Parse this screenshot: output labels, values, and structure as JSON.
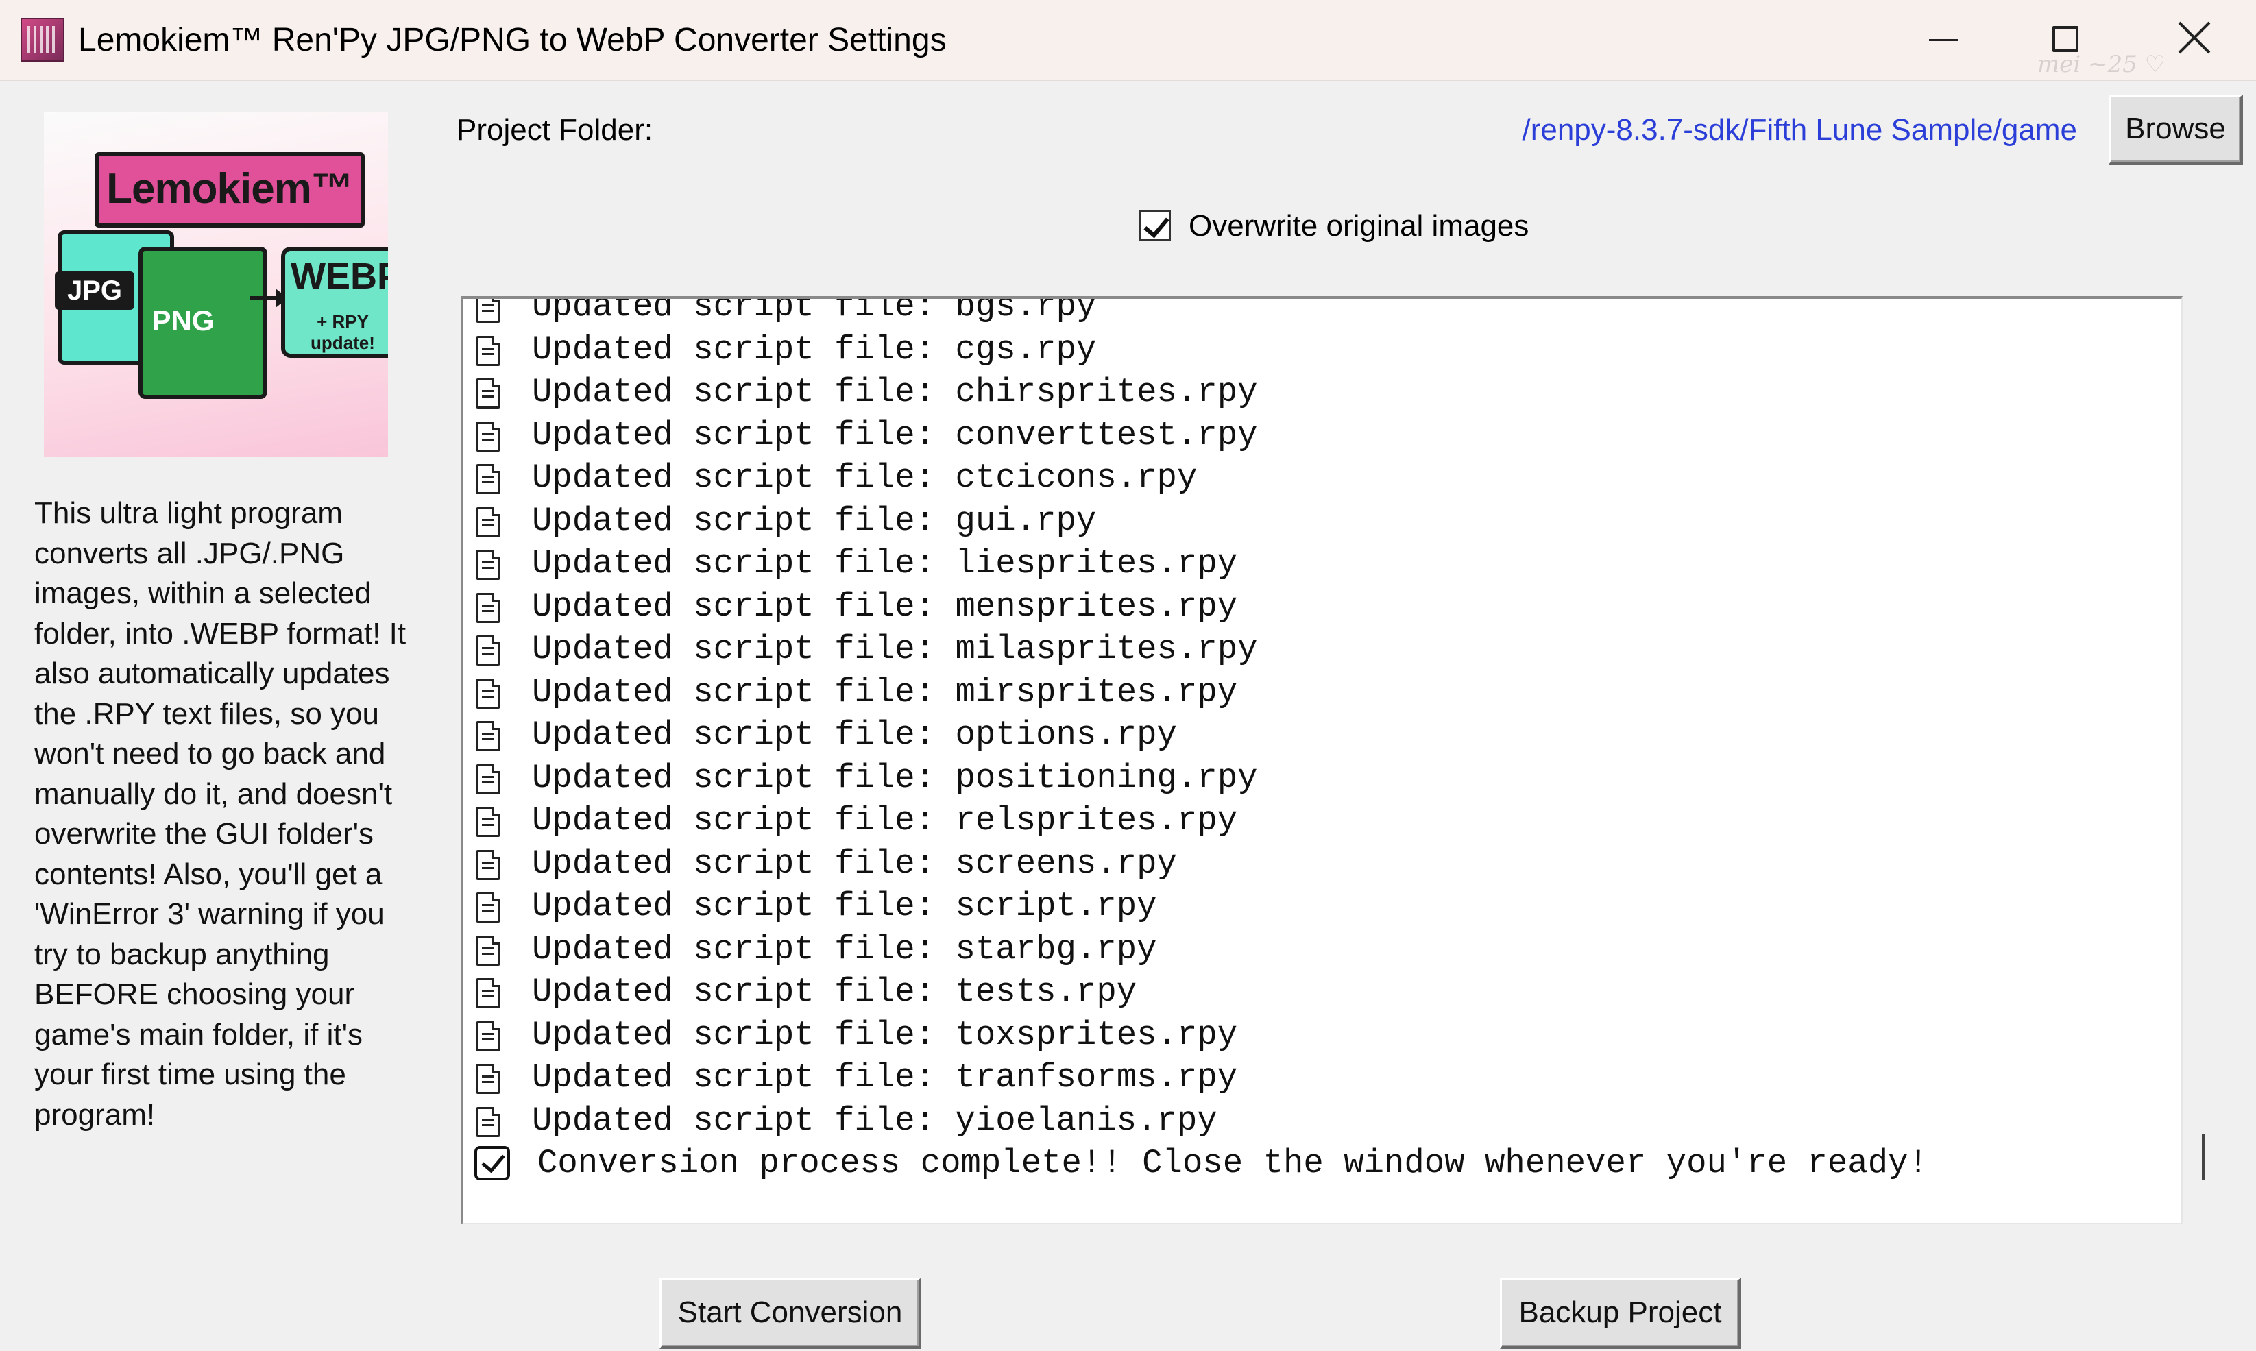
{
  "window": {
    "title": "Lemokiem™ Ren'Py JPG/PNG to WebP Converter Settings",
    "controls": {
      "minimize": "minimize-icon",
      "maximize": "maximize-icon",
      "close": "close-icon"
    }
  },
  "logo": {
    "brand": "Lemokiem™",
    "jpg": "JPG",
    "png": "PNG",
    "webp": "WEBP",
    "rpy": "+ RPY update!"
  },
  "description": "This ultra light program converts all .JPG/.PNG images, within a selected folder, into .WEBP format! It also automatically updates the .RPY text files, so you won't need to go back and manually do it, and doesn't overwrite the GUI folder's contents! Also, you'll get a 'WinError 3' warning if you try to backup anything BEFORE choosing your game's main folder, if it's your first time using the program!",
  "project_folder": {
    "label": "Project Folder:",
    "path": "/renpy-8.3.7-sdk/Fifth Lune Sample/game",
    "browse_label": "Browse"
  },
  "overwrite": {
    "label": "Overwrite original images",
    "checked": true
  },
  "log": {
    "lines": [
      "Updated script file: bgs.rpy",
      "Updated script file: cgs.rpy",
      "Updated script file: chirsprites.rpy",
      "Updated script file: converttest.rpy",
      "Updated script file: ctcicons.rpy",
      "Updated script file: gui.rpy",
      "Updated script file: liesprites.rpy",
      "Updated script file: mensprites.rpy",
      "Updated script file: milasprites.rpy",
      "Updated script file: mirsprites.rpy",
      "Updated script file: options.rpy",
      "Updated script file: positioning.rpy",
      "Updated script file: relsprites.rpy",
      "Updated script file: screens.rpy",
      "Updated script file: script.rpy",
      "Updated script file: starbg.rpy",
      "Updated script file: tests.rpy",
      "Updated script file: toxsprites.rpy",
      "Updated script file: tranfsorms.rpy",
      "Updated script file: yioelanis.rpy"
    ],
    "final": "Conversion process complete!! Close the window whenever you're ready!"
  },
  "buttons": {
    "start": "Start Conversion",
    "backup": "Backup Project"
  },
  "watermark": "mei ~25 ♡"
}
